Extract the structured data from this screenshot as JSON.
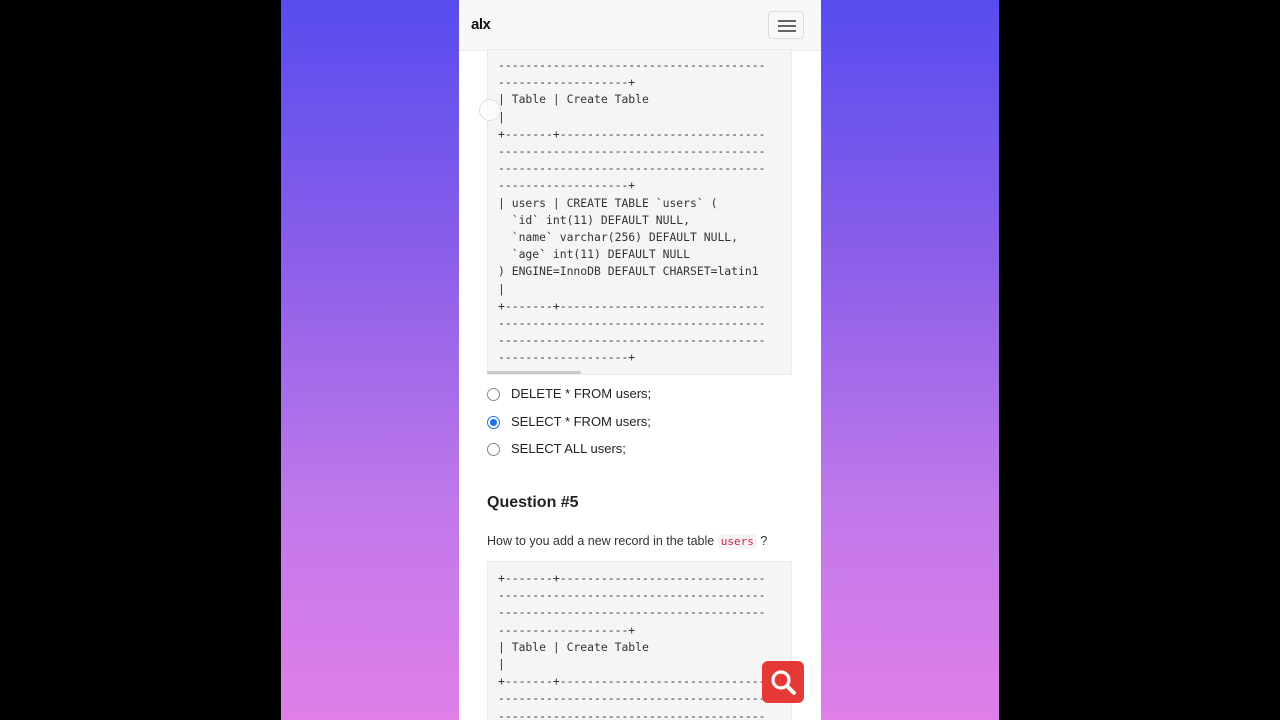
{
  "header": {
    "logo": "alx",
    "menu_icon": "hamburger-icon"
  },
  "code_block_1": {
    "text": "---------------------------------------\n-------------------+\n| Table | Create Table\n|\n+-------+------------------------------\n---------------------------------------\n---------------------------------------\n-------------------+\n| users | CREATE TABLE `users` (\n  `id` int(11) DEFAULT NULL,\n  `name` varchar(256) DEFAULT NULL,\n  `age` int(11) DEFAULT NULL\n) ENGINE=InnoDB DEFAULT CHARSET=latin1\n|\n+-------+------------------------------\n---------------------------------------\n---------------------------------------\n-------------------+"
  },
  "options": [
    {
      "label": "DELETE * FROM users;",
      "checked": false
    },
    {
      "label": "SELECT * FROM users;",
      "checked": true
    },
    {
      "label": "SELECT ALL users;",
      "checked": false
    }
  ],
  "question": {
    "title": "Question #5",
    "text_before": "How to you add a new record in the table",
    "code": "users",
    "text_after": "?"
  },
  "code_block_2": {
    "text": "+-------+------------------------------\n---------------------------------------\n---------------------------------------\n-------------------+\n| Table | Create Table\n|\n+-------+------------------------------\n---------------------------------------\n---------------------------------------"
  },
  "fab": {
    "icon": "search-icon",
    "color": "#e53935"
  },
  "colors": {
    "accent": "#1a73e8",
    "background_top": "#574cef",
    "background_bottom": "#e07fe8"
  }
}
